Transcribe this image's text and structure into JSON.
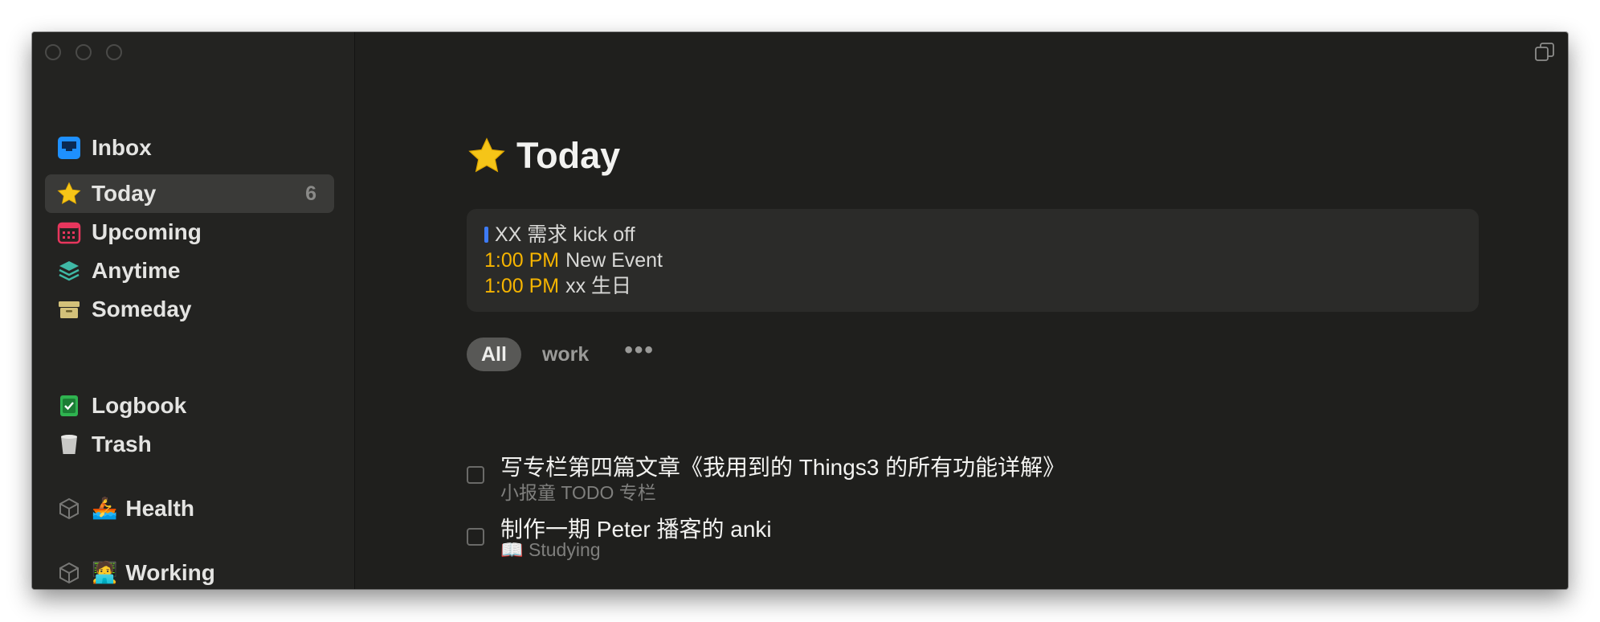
{
  "window": {
    "traffic_lights": [
      "close",
      "minimize",
      "zoom"
    ]
  },
  "sidebar": {
    "items": [
      {
        "label": "Inbox",
        "icon": "inbox-icon",
        "color": "#1e90ff"
      },
      {
        "label": "Today",
        "icon": "star-icon",
        "color": "#f5c518",
        "count": "6",
        "selected": true
      },
      {
        "label": "Upcoming",
        "icon": "calendar-icon",
        "color": "#e8365d"
      },
      {
        "label": "Anytime",
        "icon": "layers-icon",
        "color": "#3fb8a5"
      },
      {
        "label": "Someday",
        "icon": "archive-box-icon",
        "color": "#d3c17a"
      },
      {
        "label": "Logbook",
        "icon": "logbook-icon",
        "color": "#2fb350"
      },
      {
        "label": "Trash",
        "icon": "trash-icon",
        "color": "#c8c8c6"
      },
      {
        "label": "Health",
        "icon": "area-cube-icon",
        "emoji": "🚣"
      },
      {
        "label": "Working",
        "icon": "area-cube-icon",
        "emoji": "🧑‍💻"
      }
    ]
  },
  "main": {
    "title": "Today",
    "title_icon": "star-icon",
    "events": [
      {
        "time": "",
        "title": "XX 需求 kick off",
        "all_day": true,
        "calendar_color": "#3d7bf5"
      },
      {
        "time": "1:00 PM",
        "title": "New Event"
      },
      {
        "time": "1:00 PM",
        "title": "xx 生日"
      }
    ],
    "filters": [
      {
        "label": "All",
        "active": true
      },
      {
        "label": "work",
        "active": false
      },
      {
        "label": "•••",
        "active": false
      }
    ],
    "tasks": [
      {
        "name": "写专栏第四篇文章《我用到的 Things3 的所有功能详解》",
        "project": "小报童 TODO 专栏"
      },
      {
        "name": "制作一期 Peter 播客的 anki",
        "project": "📖 Studying"
      }
    ]
  },
  "colors": {
    "accent_time": "#f7b500",
    "background": "#1f1f1d",
    "sidebar": "#232321"
  }
}
